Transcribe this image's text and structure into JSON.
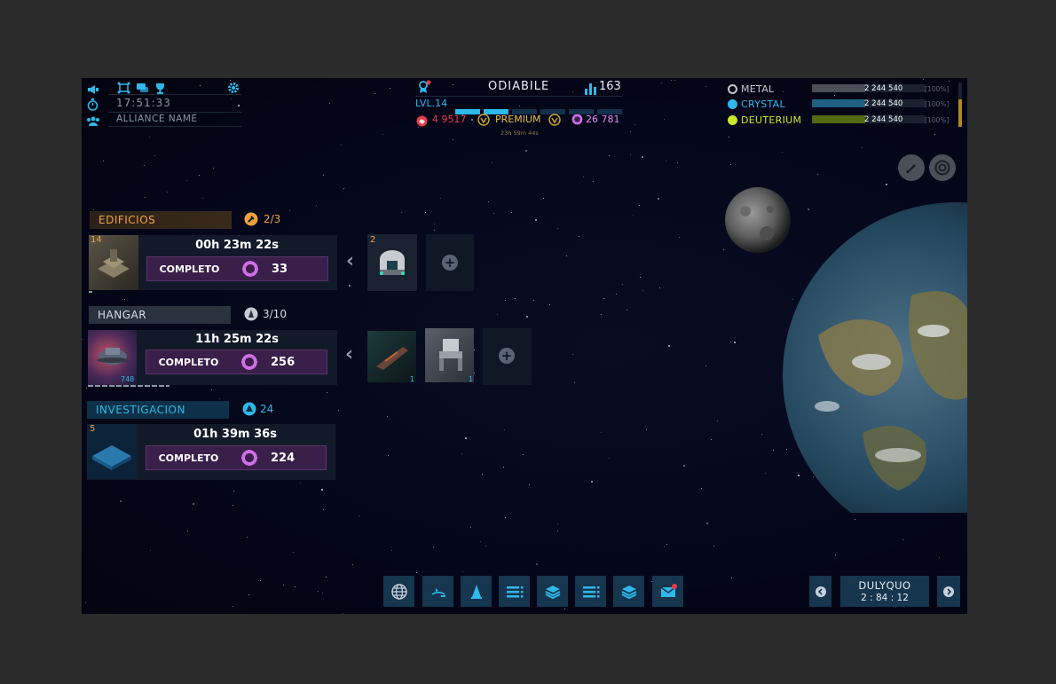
{
  "header": {
    "clock": "17:51:33",
    "alliance": "ALLIANCE NAME",
    "player_name": "ODIABILE",
    "rank": "163",
    "level": "LVL.14",
    "red_currency": "4 9517",
    "premium_label": "PREMIUM",
    "premium_timer": "23h 59m 44s",
    "purple_currency": "26 781"
  },
  "resources": [
    {
      "name": "METAL",
      "value": "2 244 540",
      "pct": "[100%]",
      "color": "#c8c8c8",
      "fill": 0.47,
      "fill_color": "#4a4e56"
    },
    {
      "name": "CRYSTAL",
      "value": "2 244 540",
      "pct": "[100%]",
      "color": "#2fb8ea",
      "fill": 0.47,
      "fill_color": "#1e5f82"
    },
    {
      "name": "DEUTERIUM",
      "value": "2 244 540",
      "pct": "[100%]",
      "color": "#c9e82a",
      "fill": 0.47,
      "fill_color": "#4f6a10"
    }
  ],
  "queues": {
    "edificios": {
      "label": "EDIFICIOS",
      "count": "2/3",
      "level": "14",
      "time": "00h 23m 22s",
      "button": "COMPLETO",
      "cost": "33",
      "next_level": "2"
    },
    "hangar": {
      "label": "HANGAR",
      "count": "3/10",
      "qty": "748",
      "time": "11h 25m 22s",
      "button": "COMPLETO",
      "cost": "256",
      "slot1_qty": "1",
      "slot2_qty": "1"
    },
    "investigacion": {
      "label": "INVESTIGACION",
      "count": "24",
      "level": "5",
      "time": "01h 39m 36s",
      "button": "COMPLETO",
      "cost": "224"
    }
  },
  "planet": {
    "name": "DULYQUO",
    "coords": "2 : 84 : 12"
  },
  "toolbar": [
    "globe-icon",
    "fleet-icon",
    "ships-icon",
    "list-icon",
    "layers-icon",
    "list2-icon",
    "layers2-icon",
    "mail-icon"
  ],
  "colors": {
    "accent": "#2fb8ea",
    "orange": "#f0a040",
    "magenta": "#d06ee8",
    "panel": "#121a2a"
  }
}
